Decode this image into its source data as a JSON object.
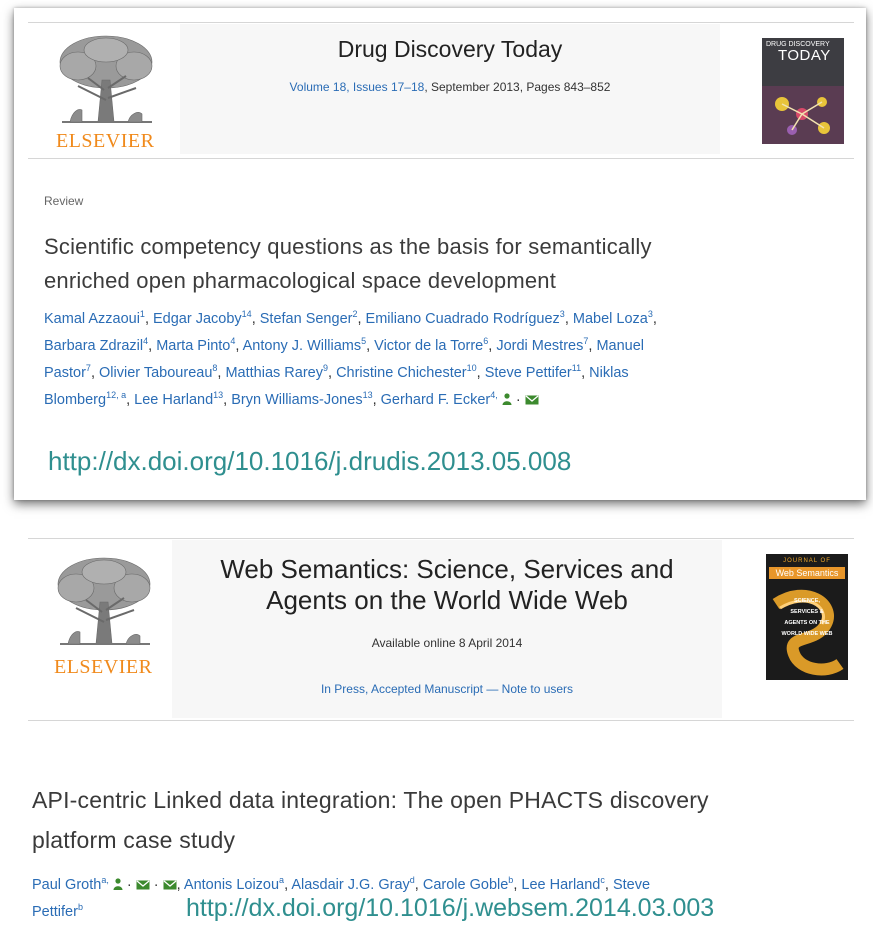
{
  "paper1": {
    "publisher": "ELSEVIER",
    "journal": "Drug Discovery Today",
    "volume_link": "Volume 18, Issues 17–18",
    "volume_rest": ", September 2013, Pages 843–852",
    "cover_title_small": "DRUG DISCOVERY",
    "cover_title_big": "TODAY",
    "section": "Review",
    "title_line1": "Scientific competency questions as the basis for semantically",
    "title_line2": "enriched open pharmacological space development",
    "authors_lines": [
      [
        {
          "name": "Kamal Azzaoui",
          "sup": "1"
        },
        {
          "name": "Edgar Jacoby",
          "sup": "14"
        },
        {
          "name": "Stefan Senger",
          "sup": "2"
        },
        {
          "name": "Emiliano Cuadrado Rodríguez",
          "sup": "3"
        },
        {
          "name": "Mabel Loza",
          "sup": "3",
          "trail": ","
        }
      ],
      [
        {
          "name": "Barbara Zdrazil",
          "sup": "4"
        },
        {
          "name": "Marta Pinto",
          "sup": "4"
        },
        {
          "name": "Antony J. Williams",
          "sup": "5"
        },
        {
          "name": "Victor de la Torre",
          "sup": "6"
        },
        {
          "name": "Jordi Mestres",
          "sup": "7"
        },
        {
          "name": "Manuel",
          "sup": ""
        }
      ],
      [
        {
          "name": "Pastor",
          "sup": "7"
        },
        {
          "name": "Olivier Taboureau",
          "sup": "8"
        },
        {
          "name": "Matthias Rarey",
          "sup": "9"
        },
        {
          "name": "Christine Chichester",
          "sup": "10"
        },
        {
          "name": "Steve Pettifer",
          "sup": "11"
        },
        {
          "name": "Niklas",
          "sup": ""
        }
      ],
      [
        {
          "name": "Blomberg",
          "sup": "12, a"
        },
        {
          "name": "Lee Harland",
          "sup": "13"
        },
        {
          "name": "Bryn Williams-Jones",
          "sup": "13"
        },
        {
          "name": "Gerhard F. Ecker",
          "sup": "4,",
          "icons": true
        }
      ]
    ],
    "doi": "http://dx.doi.org/10.1016/j.drudis.2013.05.008"
  },
  "paper2": {
    "publisher": "ELSEVIER",
    "journal_line1": "Web Semantics: Science, Services and",
    "journal_line2": "Agents on the World Wide Web",
    "available": "Available online 8 April 2014",
    "in_press": "In Press, Accepted Manuscript — Note to users",
    "cover_small": "JOURNAL OF",
    "cover_big": "Web Semantics",
    "cover_lines": [
      "SCIENCE,",
      "SERVICES &",
      "AGENTS ON THE",
      "WORLD WIDE WEB"
    ],
    "title_line1": "API-centric Linked data integration: The open PHACTS discovery",
    "title_line2": "platform case study",
    "authors": [
      {
        "name": "Paul Groth",
        "sup": "a,"
      },
      {
        "name": "Antonis Loizou",
        "sup": "a"
      },
      {
        "name": "Alasdair J.G. Gray",
        "sup": "d"
      },
      {
        "name": "Carole Goble",
        "sup": "b"
      },
      {
        "name": "Lee Harland",
        "sup": "c"
      },
      {
        "name": "Steve",
        "sup": ""
      },
      {
        "name": "Pettifer",
        "sup": "b"
      }
    ],
    "doi": "http://dx.doi.org/10.1016/j.websem.2014.03.003"
  },
  "colors": {
    "link": "#2a6cb5",
    "doi": "#2f8f8f",
    "elsevier_orange": "#f08a1c",
    "icon_green": "#3c8a2e"
  }
}
